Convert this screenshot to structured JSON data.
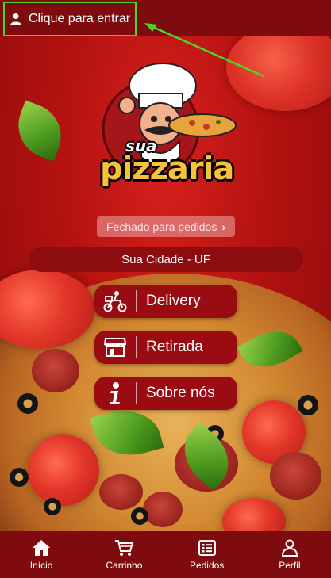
{
  "header": {
    "login_label": "Clique para entrar",
    "user_icon": "user-icon",
    "highlight_color": "#4cd62a"
  },
  "brand": {
    "logo_word1": "sua",
    "logo_word2": "pizzaria"
  },
  "store": {
    "status_label": "Fechado para pedidos",
    "city_label": "Sua Cidade - UF"
  },
  "actions": [
    {
      "label": "Delivery",
      "icon": "delivery-scooter-icon"
    },
    {
      "label": "Retirada",
      "icon": "store-icon"
    },
    {
      "label": "Sobre nós",
      "icon": "info-icon"
    }
  ],
  "bottom_nav": [
    {
      "label": "Início",
      "icon": "home-icon"
    },
    {
      "label": "Carrinho",
      "icon": "cart-icon"
    },
    {
      "label": "Pedidos",
      "icon": "orders-icon"
    },
    {
      "label": "Perfil",
      "icon": "profile-icon"
    }
  ],
  "colors": {
    "primary": "#7e0c0f",
    "button": "#9a0c12"
  }
}
